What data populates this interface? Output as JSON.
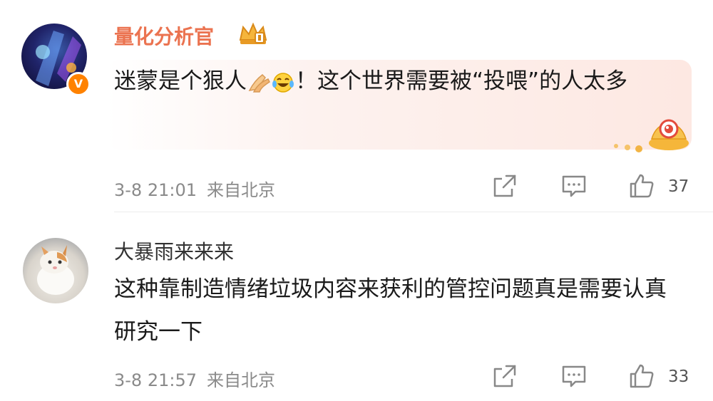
{
  "comments": [
    {
      "username": "量化分析官",
      "verified_badge": "V",
      "text_before": "迷蒙是个狠人",
      "emojis": [
        "clapping-hands-icon",
        "tears-of-joy-icon"
      ],
      "text_after": "！这个世界需要被“投喂”的人太多",
      "date": "3-8 21:01",
      "location": "来自北京",
      "likes": "37",
      "name_color": "#eb7350"
    },
    {
      "username": "大暴雨来来来",
      "text": "这种靠制造情绪垃圾内容来获利的管控问题真是需要认真研究一下",
      "date": "3-8 21:57",
      "location": "来自北京",
      "likes": "33"
    }
  ],
  "icons": {
    "share": "share-icon",
    "comment": "comment-icon",
    "like": "thumbs-up-icon",
    "crown": "vip-crown-icon",
    "ingot": "gold-ingot-icon"
  }
}
